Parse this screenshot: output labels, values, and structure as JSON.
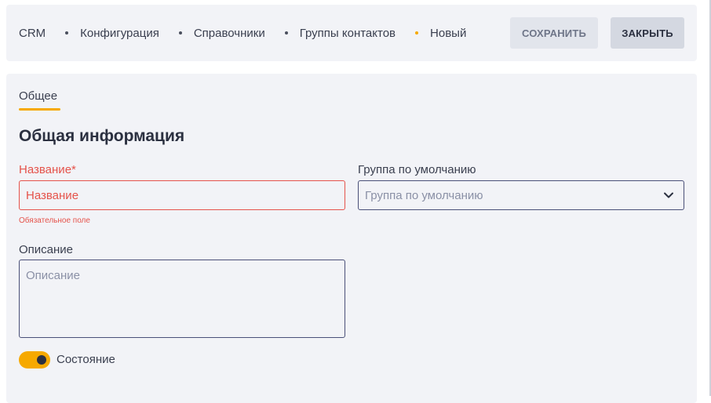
{
  "breadcrumb": {
    "items": [
      "CRM",
      "Конфигурация",
      "Справочники",
      "Группы контактов",
      "Новый"
    ]
  },
  "toolbar": {
    "save_label": "СОХРАНИТЬ",
    "close_label": "ЗАКРЫТЬ"
  },
  "tabs": [
    {
      "label": "Общее",
      "active": true
    }
  ],
  "section": {
    "title": "Общая информация"
  },
  "form": {
    "name": {
      "label": "Название*",
      "placeholder": "Название",
      "error": "Обязательное поле"
    },
    "default_group": {
      "label": "Группа по умолчанию",
      "placeholder": "Группа по умолчанию"
    },
    "description": {
      "label": "Описание",
      "placeholder": "Описание"
    },
    "state": {
      "label": "Состояние",
      "enabled": true
    }
  },
  "colors": {
    "accent": "#f6a900",
    "error": "#e5534b",
    "panel": "#f2f3f7",
    "text": "#2b3040"
  },
  "icons": [
    "chevron-down-icon"
  ]
}
